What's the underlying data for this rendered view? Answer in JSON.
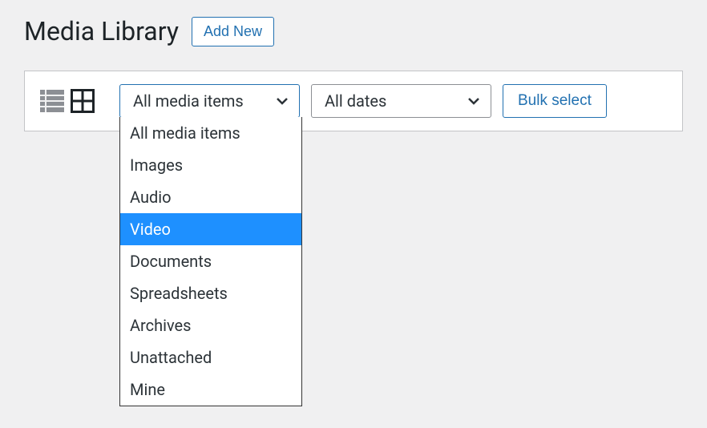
{
  "header": {
    "title": "Media Library",
    "add_new_label": "Add New"
  },
  "toolbar": {
    "media_filter": {
      "selected": "All media items",
      "options": [
        {
          "label": "All media items",
          "highlighted": false
        },
        {
          "label": "Images",
          "highlighted": false
        },
        {
          "label": "Audio",
          "highlighted": false
        },
        {
          "label": "Video",
          "highlighted": true
        },
        {
          "label": "Documents",
          "highlighted": false
        },
        {
          "label": "Spreadsheets",
          "highlighted": false
        },
        {
          "label": "Archives",
          "highlighted": false
        },
        {
          "label": "Unattached",
          "highlighted": false
        },
        {
          "label": "Mine",
          "highlighted": false
        }
      ]
    },
    "date_filter": {
      "selected": "All dates"
    },
    "bulk_select_label": "Bulk select"
  }
}
